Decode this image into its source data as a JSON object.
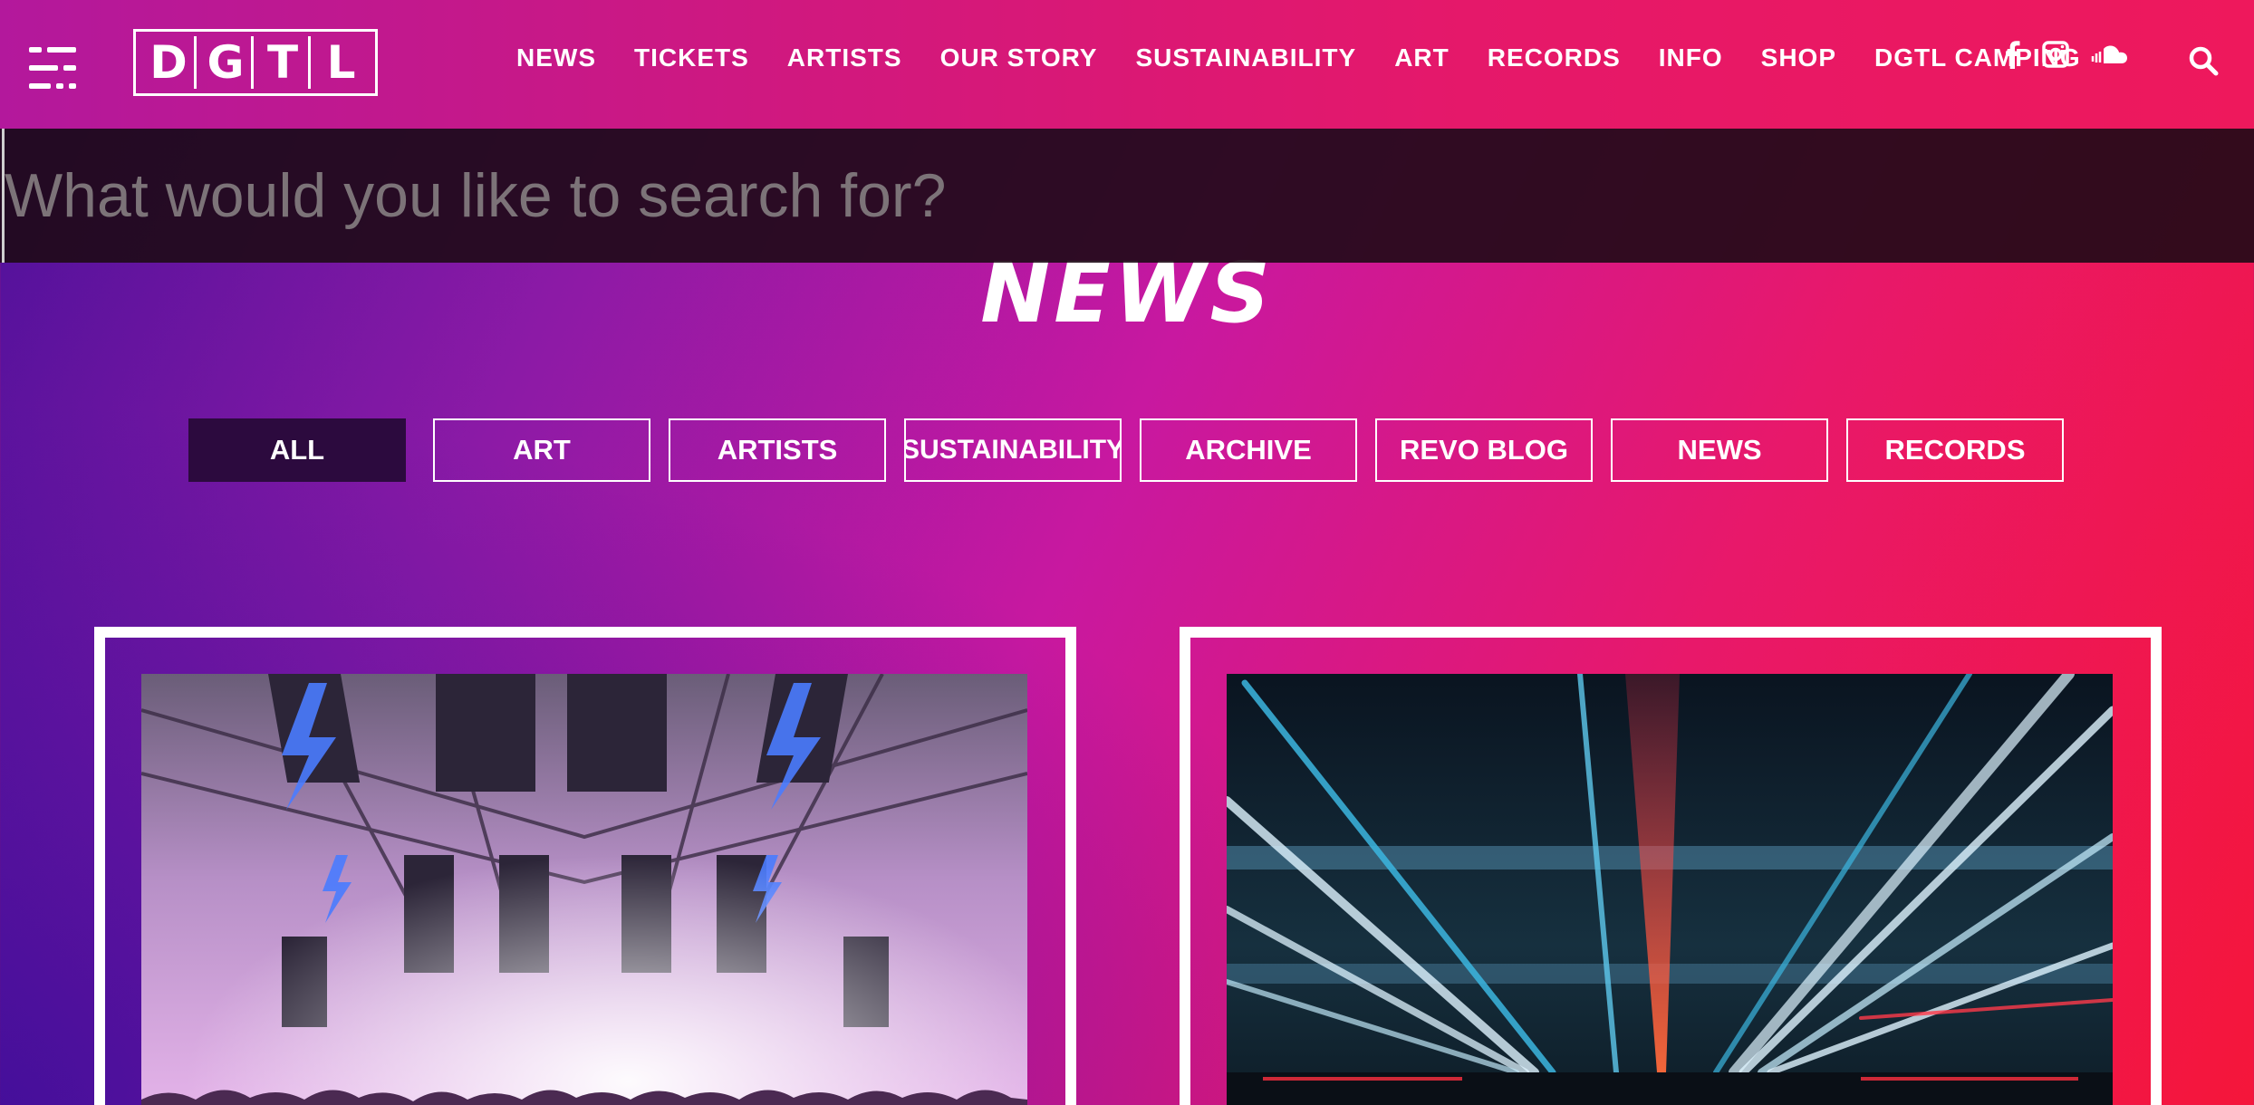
{
  "header": {
    "logo_letters": [
      "D",
      "G",
      "T",
      "L"
    ],
    "nav": [
      "NEWS",
      "TICKETS",
      "ARTISTS",
      "OUR STORY",
      "SUSTAINABILITY",
      "ART",
      "RECORDS",
      "INFO",
      "SHOP",
      "DGTL CAMPING"
    ],
    "social_icons": [
      "facebook-icon",
      "instagram-icon",
      "soundcloud-icon"
    ],
    "menu_icon": "menu-icon",
    "search_icon": "search-icon"
  },
  "search": {
    "placeholder": "What would you like to search for?",
    "value": ""
  },
  "page": {
    "title": "NEWS"
  },
  "filters": {
    "active": "ALL",
    "items": [
      "ALL",
      "ART",
      "ARTISTS",
      "SUSTAINABILITY",
      "ARCHIVE",
      "REVO BLOG",
      "NEWS",
      "RECORDS"
    ]
  },
  "cards": [
    {
      "image": "festival-stage-purple-lightning"
    },
    {
      "image": "festival-light-beams-blue-red"
    }
  ],
  "colors": {
    "gradient_start": "#4a109a",
    "gradient_mid": "#c818a0",
    "gradient_end": "#f5163a",
    "active_filter_bg": "#2c0a3e",
    "search_bar_bg": "#1e0a16"
  }
}
